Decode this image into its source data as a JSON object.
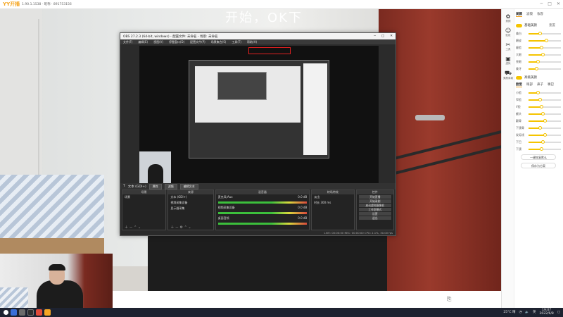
{
  "app": {
    "name": "YY开播",
    "info": "1.90.1.1538 · 昵称 · 891753156"
  },
  "window_controls": [
    "─",
    "□",
    "✕"
  ],
  "scene": {
    "overlay_text": "开始，OK下"
  },
  "obs": {
    "title": "OBS 27.2.3 (64-bit, windows) - 配置文件: 未命名 - 场景: 未命名",
    "menu": [
      "文件(F)",
      "编辑(E)",
      "视图(V)",
      "停靠窗口(D)",
      "配置文件(P)",
      "场景集合(S)",
      "工具(T)",
      "帮助(H)"
    ],
    "statusline": {
      "label": "文本 (GDI+)",
      "props_btn": "属性",
      "filters_btn": "滤镜",
      "edit_btn": "编辑文本"
    },
    "docks": {
      "scenes": {
        "header": "场景",
        "items": [
          "场景"
        ]
      },
      "sources": {
        "header": "来源",
        "items": [
          "文本 (GDI+)",
          "视频采集设备",
          "显示器采集"
        ]
      },
      "mixer": {
        "header": "混音器",
        "channels": [
          {
            "name": "麦克风/Aux",
            "db": "0.0 dB"
          },
          {
            "name": "视频采集设备",
            "db": "0.0 dB"
          },
          {
            "name": "桌面音频",
            "db": "0.0 dB"
          }
        ]
      },
      "transitions": {
        "header": "转场特效",
        "type": "淡出",
        "duration_label": "时长",
        "duration": "300 ms"
      },
      "controls": {
        "header": "控件",
        "buttons": [
          "开始直播",
          "开始录制",
          "启动虚拟摄像机",
          "工作室模式",
          "设置",
          "退出"
        ]
      }
    },
    "status": "LIVE: 00:00:00  REC: 00:00:00  CPU: 2.1%, 30.00 fps"
  },
  "right_panel": {
    "side_icons": [
      {
        "icon": "beauty-icon",
        "label": "美颜"
      },
      {
        "icon": "sticker-icon",
        "label": "贴纸"
      },
      {
        "icon": "tools-icon",
        "label": "工具"
      },
      {
        "icon": "background-icon",
        "label": "虚拟"
      },
      {
        "icon": "shop-icon",
        "label": "美颜商城"
      }
    ],
    "tabs": [
      "美颜",
      "滤镜",
      "妆容"
    ],
    "section1": {
      "title": "基础美颜",
      "reset": "重置"
    },
    "sliders1": [
      {
        "label": "美白",
        "value": 0.35
      },
      {
        "label": "磨皮",
        "value": 0.55
      },
      {
        "label": "瘦脸",
        "value": 0.4
      },
      {
        "label": "大眼",
        "value": 0.45
      },
      {
        "label": "亮眼",
        "value": 0.3
      },
      {
        "label": "美牙",
        "value": 0.25
      }
    ],
    "section2": {
      "title": "高级美颜"
    },
    "tabs2": [
      "脸型",
      "眼部",
      "鼻子",
      "嘴巴"
    ],
    "sliders2": [
      {
        "label": "小脸",
        "value": 0.3
      },
      {
        "label": "窄脸",
        "value": 0.35
      },
      {
        "label": "V脸",
        "value": 0.4
      },
      {
        "label": "额头",
        "value": 0.45
      },
      {
        "label": "颧骨",
        "value": 0.5
      },
      {
        "label": "下颌骨",
        "value": 0.35
      },
      {
        "label": "发际线",
        "value": 0.5
      },
      {
        "label": "下巴",
        "value": 0.45
      },
      {
        "label": "下颌",
        "value": 0.4
      }
    ],
    "buttons": [
      "一键恢复默认",
      "保存为方案"
    ]
  },
  "taskbar": {
    "weather": "25°C 晴",
    "lang": "英",
    "time": "19:07",
    "date": "2022/6/8"
  },
  "colors": {
    "accent": "#f5c400",
    "taskbar": "#1d2230",
    "obs_bg": "#2b2b2b"
  }
}
